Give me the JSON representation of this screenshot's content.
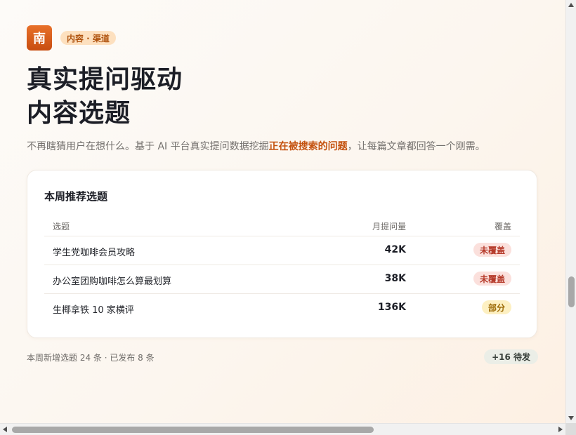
{
  "header": {
    "logo_char": "南",
    "tag": "内容 · 渠道"
  },
  "hero": {
    "title_line1": "真实提问驱动",
    "title_line2": "内容选题",
    "subtitle_before": "不再瞎猜用户在想什么。基于 AI 平台真实提问数据挖掘",
    "subtitle_highlight": "正在被搜索的问题",
    "subtitle_after": "，让每篇文章都回答一个刚需。"
  },
  "card": {
    "title": "本周推荐选题",
    "columns": {
      "topic": "选题",
      "volume": "月提问量",
      "coverage": "覆盖"
    },
    "rows": [
      {
        "topic": "学生党咖啡会员攻略",
        "volume": "42K",
        "coverage": "未覆盖",
        "status": "uncovered"
      },
      {
        "topic": "办公室团购咖啡怎么算最划算",
        "volume": "38K",
        "coverage": "未覆盖",
        "status": "uncovered"
      },
      {
        "topic": "生椰拿铁 10 家横评",
        "volume": "136K",
        "coverage": "部分",
        "status": "partial"
      }
    ]
  },
  "footer": {
    "summary": "本周新增选题 24 条 · 已发布 8 条",
    "pending": "+16 待发"
  },
  "colors": {
    "brand": "#d35a16",
    "highlight": "#c4520f",
    "uncovered_bg": "#fbe0dc",
    "partial_bg": "#fdf0c2"
  }
}
